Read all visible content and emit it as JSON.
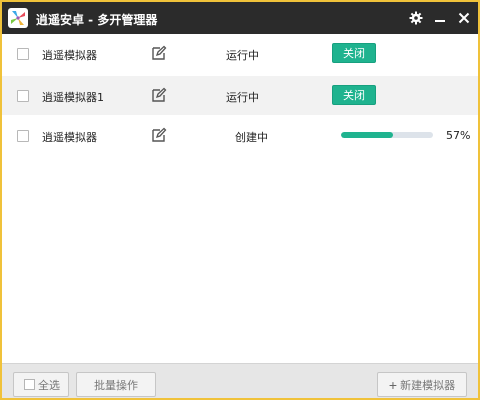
{
  "window": {
    "title": "逍遥安卓 - 多开管理器",
    "accent_color": "#1fb38f",
    "border_color": "#f0c23a"
  },
  "titlebar_icons": {
    "settings": "gear-icon",
    "minimize": "minimize-icon",
    "close": "close-icon"
  },
  "rows": [
    {
      "name": "逍遥模拟器",
      "status": "运行中",
      "action": "关闭"
    },
    {
      "name": "逍遥模拟器1",
      "status": "运行中",
      "action": "关闭"
    },
    {
      "name": "逍遥模拟器",
      "status": "创建中",
      "progress": 0.57,
      "progress_label": "57%"
    }
  ],
  "footer": {
    "select_all": "全选",
    "batch": "批量操作",
    "new": "新建模拟器"
  }
}
